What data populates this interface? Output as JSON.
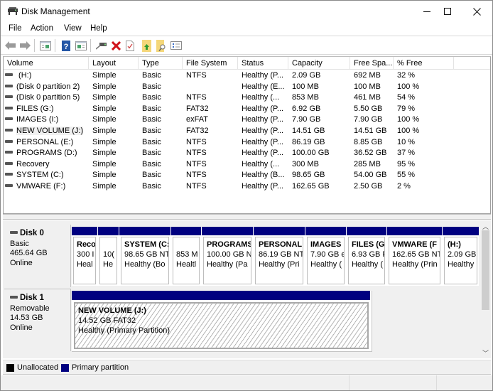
{
  "window": {
    "title": "Disk Management",
    "controls": {
      "minimize": "—",
      "maximize": "☐",
      "close": "✕"
    }
  },
  "menu": [
    "File",
    "Action",
    "View",
    "Help"
  ],
  "toolbar": {
    "icons": [
      "back-icon",
      "forward-icon",
      "show-hide-console-tree-icon",
      "help-icon",
      "show-hide-action-pane-icon",
      "connect-disk-icon",
      "delete-icon",
      "properties-icon",
      "open-folder-icon",
      "explore-icon",
      "details-icon"
    ]
  },
  "volume_list": {
    "columns": [
      "Volume",
      "Layout",
      "Type",
      "File System",
      "Status",
      "Capacity",
      "Free Spa...",
      "% Free"
    ],
    "rows": [
      {
        "volume": " (H:)",
        "layout": "Simple",
        "type": "Basic",
        "fs": "NTFS",
        "status": "Healthy (P...",
        "capacity": "2.09 GB",
        "free": "692 MB",
        "pct": "32 %"
      },
      {
        "volume": "(Disk 0 partition 2)",
        "layout": "Simple",
        "type": "Basic",
        "fs": "",
        "status": "Healthy (E...",
        "capacity": "100 MB",
        "free": "100 MB",
        "pct": "100 %"
      },
      {
        "volume": "(Disk 0 partition 5)",
        "layout": "Simple",
        "type": "Basic",
        "fs": "NTFS",
        "status": "Healthy (...",
        "capacity": "853 MB",
        "free": "461 MB",
        "pct": "54 %"
      },
      {
        "volume": "FILES (G:)",
        "layout": "Simple",
        "type": "Basic",
        "fs": "FAT32",
        "status": "Healthy (P...",
        "capacity": "6.92 GB",
        "free": "5.50 GB",
        "pct": "79 %"
      },
      {
        "volume": "IMAGES (I:)",
        "layout": "Simple",
        "type": "Basic",
        "fs": "exFAT",
        "status": "Healthy (P...",
        "capacity": "7.90 GB",
        "free": "7.90 GB",
        "pct": "100 %"
      },
      {
        "volume": "NEW VOLUME (J:)",
        "layout": "Simple",
        "type": "Basic",
        "fs": "FAT32",
        "status": "Healthy (P...",
        "capacity": "14.51 GB",
        "free": "14.51 GB",
        "pct": "100 %",
        "selected": true
      },
      {
        "volume": "PERSONAL (E:)",
        "layout": "Simple",
        "type": "Basic",
        "fs": "NTFS",
        "status": "Healthy (P...",
        "capacity": "86.19 GB",
        "free": "8.85 GB",
        "pct": "10 %"
      },
      {
        "volume": "PROGRAMS (D:)",
        "layout": "Simple",
        "type": "Basic",
        "fs": "NTFS",
        "status": "Healthy (P...",
        "capacity": "100.00 GB",
        "free": "36.52 GB",
        "pct": "37 %"
      },
      {
        "volume": "Recovery",
        "layout": "Simple",
        "type": "Basic",
        "fs": "NTFS",
        "status": "Healthy (...",
        "capacity": "300 MB",
        "free": "285 MB",
        "pct": "95 %"
      },
      {
        "volume": "SYSTEM (C:)",
        "layout": "Simple",
        "type": "Basic",
        "fs": "NTFS",
        "status": "Healthy (B...",
        "capacity": "98.65 GB",
        "free": "54.00 GB",
        "pct": "55 %"
      },
      {
        "volume": "VMWARE (F:)",
        "layout": "Simple",
        "type": "Basic",
        "fs": "NTFS",
        "status": "Healthy (P...",
        "capacity": "162.65 GB",
        "free": "2.50 GB",
        "pct": "2 %"
      }
    ]
  },
  "disks": [
    {
      "name": "Disk 0",
      "kind": "Basic",
      "size": "465.64 GB",
      "state": "Online",
      "partitions": [
        {
          "name": "Reco",
          "line2": "300 I",
          "line3": "Heal"
        },
        {
          "name": "",
          "line2": "10(",
          "line3": "He"
        },
        {
          "name": "SYSTEM  (C:",
          "line2": "98.65 GB NT",
          "line3": "Healthy (Bo"
        },
        {
          "name": "",
          "line2": "853 M",
          "line3": "Healtl"
        },
        {
          "name": "PROGRAMS",
          "line2": "100.00 GB N",
          "line3": "Healthy (Pa"
        },
        {
          "name": "PERSONAL",
          "line2": "86.19 GB NT",
          "line3": "Healthy (Pri"
        },
        {
          "name": "IMAGES",
          "line2": "7.90 GB e",
          "line3": "Healthy ("
        },
        {
          "name": "FILES  (G",
          "line2": "6.93 GB F",
          "line3": "Healthy ("
        },
        {
          "name": "VMWARE  (F",
          "line2": "162.65 GB NT",
          "line3": "Healthy (Prin"
        },
        {
          "name": " (H:)",
          "line2": "2.09 GB",
          "line3": "Healthy"
        }
      ]
    },
    {
      "name": "Disk 1",
      "kind": "Removable",
      "size": "14.53 GB",
      "state": "Online",
      "partitions": [
        {
          "name": "NEW VOLUME  (J:)",
          "line2": "14.52 GB FAT32",
          "line3": "Healthy (Primary Partition)",
          "selected": true
        }
      ]
    }
  ],
  "legend": [
    {
      "label": "Unallocated",
      "color": "#000000"
    },
    {
      "label": "Primary partition",
      "color": "#000080"
    }
  ],
  "colors": {
    "primary_partition": "#000080",
    "unallocated": "#000000"
  }
}
